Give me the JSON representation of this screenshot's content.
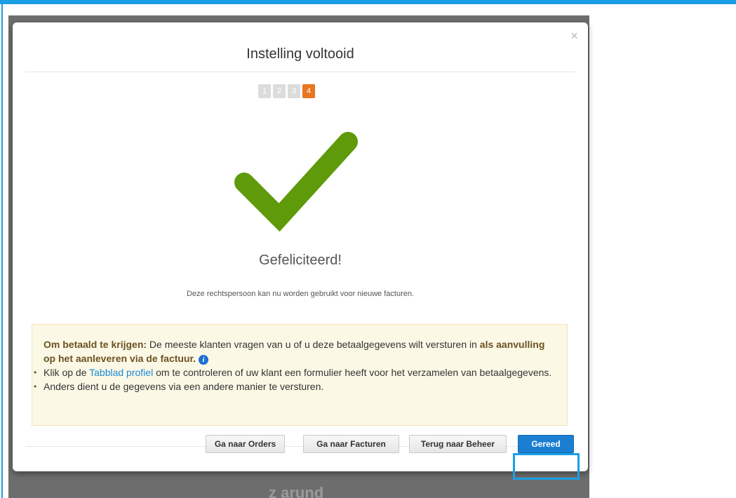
{
  "modal": {
    "close_label": "×",
    "title": "Instelling voltooid",
    "steps": [
      "1",
      "2",
      "3",
      "4"
    ],
    "active_step": "4",
    "congrats": "Gefeliciteerd!",
    "subtext": "Deze rechtspersoon kan nu worden gebruikt voor nieuwe facturen."
  },
  "info_box": {
    "lead_bold": "Om betaald te krijgen:",
    "lead_text": " De meeste klanten vragen van u of u deze betaalgegevens wilt versturen in ",
    "lead_bold_2": "als aanvulling op het aanleveren via de factuur.",
    "info_icon": "i",
    "bullet_1_prefix": "Klik op de ",
    "bullet_1_link": "Tabblad profiel",
    "bullet_1_suffix": " om te controleren of uw klant een formulier heeft voor het verzamelen van betaalgegevens.",
    "bullet_2": "Anders dient u de gegevens via een andere manier te versturen."
  },
  "footer": {
    "btn_orders": "Ga naar Orders",
    "btn_invoices": "Ga naar Facturen",
    "btn_back": "Terug naar Beheer",
    "btn_done": "Gereed"
  },
  "background": {
    "bottom_text": "z arund"
  },
  "colors": {
    "accent_blue": "#1b9ee5",
    "step_active": "#ea7521",
    "check_green": "#5e9a0a",
    "primary_button": "#1b7fd1"
  },
  "icons": {
    "close": "close-icon",
    "check": "checkmark-icon",
    "info": "info-icon"
  }
}
